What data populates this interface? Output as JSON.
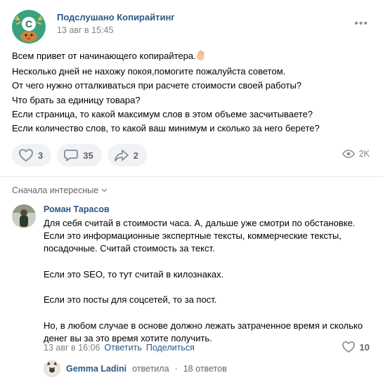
{
  "post": {
    "group_name": "Подслушано Копирайтинг",
    "date": "13 авг в 15:45",
    "text_lines": [
      "Всем привет от начинающего копирайтера.",
      "Несколько дней не нахожу покоя,помогите пожалуйста советом.",
      "От чего нужно отталкиваться при расчете стоимости своей работы?",
      "Что брать за единицу товара?",
      "Если страница, то какой максимум слов в этом объеме засчитываете?",
      "Если количество слов, то какой ваш минимум и сколько за него берете?"
    ],
    "likes": "3",
    "comments": "35",
    "shares": "2",
    "views": "2K"
  },
  "comments_section": {
    "sort_label": "Сначала интересные"
  },
  "comment": {
    "author": "Роман Тарасов",
    "text_lines": [
      "Для себя считай в стоимости часа. А, дальше уже смотри по обстановке.",
      "Если это информационные экспертные тексты, коммерческие тексты,",
      "посадочные. Считай стоимость за текст.",
      "",
      "Если это SEO, то тут считай в килознаках.",
      "",
      "Если это посты для соцсетей, то за пост.",
      "",
      "Но, в любом случае в основе должно лежать затраченное время и сколько",
      "денег вы за это время хотите получить."
    ],
    "date": "13 авг в 16:06",
    "reply_label": "Ответить",
    "share_label": "Поделиться",
    "likes": "10"
  },
  "reply": {
    "author": "Gemma Ladini",
    "action": "ответила",
    "separator": "·",
    "count": "18 ответов"
  },
  "colors": {
    "link": "#2a5885",
    "muted": "#828282",
    "pill_bg": "#f0f2f5",
    "logo_green": "#3aa17e"
  }
}
